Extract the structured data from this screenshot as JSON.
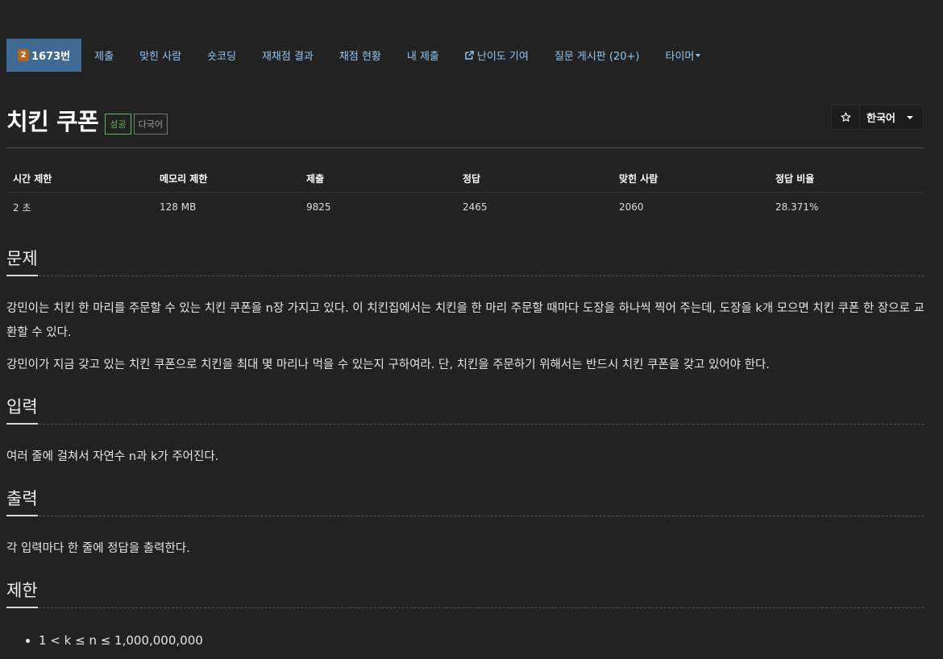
{
  "nav": {
    "problem_number": "1673번",
    "tier_badge": "2",
    "tier_color": "#b5651d",
    "links": {
      "submit": "제출",
      "solvers": "맞힌 사람",
      "short_coding": "숏코딩",
      "rejudge": "재채점 결과",
      "status": "채점 현황",
      "my_submissions": "내 제출",
      "difficulty": "난이도 기여",
      "board": "질문 게시판 (20+)",
      "timer": "타이머"
    }
  },
  "title": {
    "text": "치킨 쿠폰",
    "label_success": "성공",
    "label_lang": "다국어",
    "star_icon": "star-icon",
    "language": "한국어"
  },
  "info": {
    "headers": [
      "시간 제한",
      "메모리 제한",
      "제출",
      "정답",
      "맞힌 사람",
      "정답 비율"
    ],
    "values": [
      "2 초",
      "128 MB",
      "9825",
      "2465",
      "2060",
      "28.371%"
    ]
  },
  "sections": {
    "problem": {
      "title": "문제",
      "p1": "강민이는 치킨 한 마리를 주문할 수 있는 치킨 쿠폰을 n장 가지고 있다. 이 치킨집에서는 치킨을 한 마리 주문할 때마다 도장을 하나씩 찍어 주는데, 도장을 k개 모으면 치킨 쿠폰 한 장으로 교환할 수 있다.",
      "p2": "강민이가 지금 갖고 있는 치킨 쿠폰으로 치킨을 최대 몇 마리나 먹을 수 있는지 구하여라. 단, 치킨을 주문하기 위해서는 반드시 치킨 쿠폰을 갖고 있어야 한다."
    },
    "input": {
      "title": "입력",
      "text": "여러 줄에 걸쳐서 자연수 n과 k가 주어진다."
    },
    "output": {
      "title": "출력",
      "text": "각 입력마다 한 줄에 정답을 출력한다."
    },
    "limits": {
      "title": "제한",
      "items": [
        "1 < k ≤ n ≤ 1,000,000,000"
      ]
    }
  }
}
